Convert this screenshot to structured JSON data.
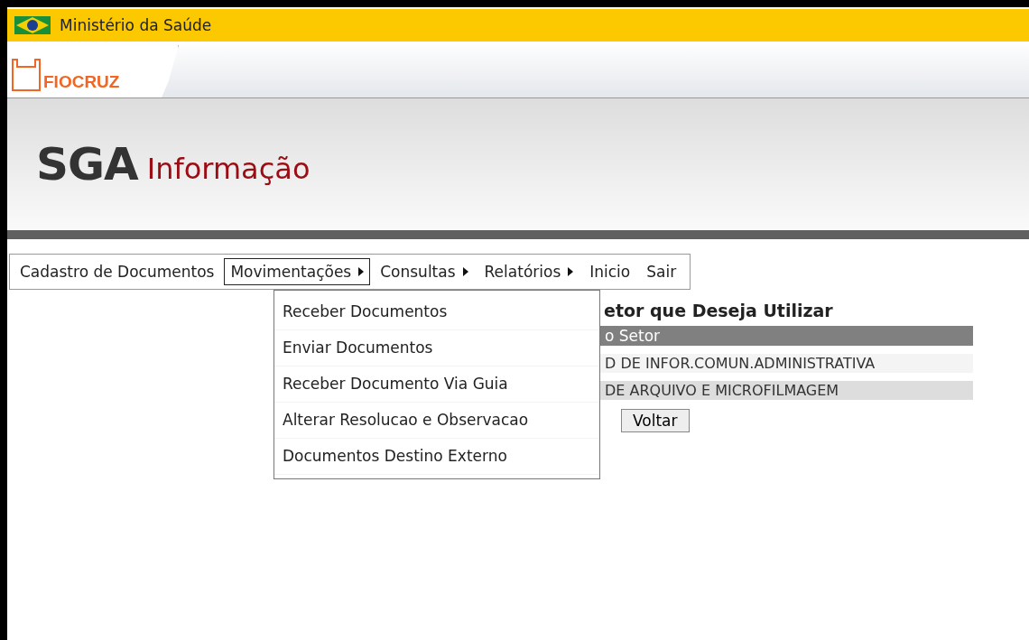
{
  "gov_bar": {
    "title": "Ministério da Saúde"
  },
  "brand_tab": {
    "label": "FIOCRUZ"
  },
  "header": {
    "logo": "SGA",
    "subtitle": "Informação"
  },
  "menu": {
    "items": [
      {
        "label": "Cadastro de Documentos",
        "has_submenu": false,
        "selected": false
      },
      {
        "label": "Movimentações",
        "has_submenu": true,
        "selected": true
      },
      {
        "label": "Consultas",
        "has_submenu": true,
        "selected": false
      },
      {
        "label": "Relatórios",
        "has_submenu": true,
        "selected": false
      },
      {
        "label": "Inicio",
        "has_submenu": false,
        "selected": false
      },
      {
        "label": "Sair",
        "has_submenu": false,
        "selected": false
      }
    ]
  },
  "dropdown": {
    "items": [
      "Receber Documentos",
      "Enviar Documentos",
      "Receber Documento Via Guia",
      "Alterar Resolucao e Observacao",
      "Documentos Destino Externo"
    ]
  },
  "content": {
    "title": "etor que Deseja Utilizar",
    "table_header": "o Setor",
    "rows": [
      "D DE INFOR.COMUN.ADMINISTRATIVA",
      "DE ARQUIVO E MICROFILMAGEM"
    ],
    "button": "Voltar"
  }
}
